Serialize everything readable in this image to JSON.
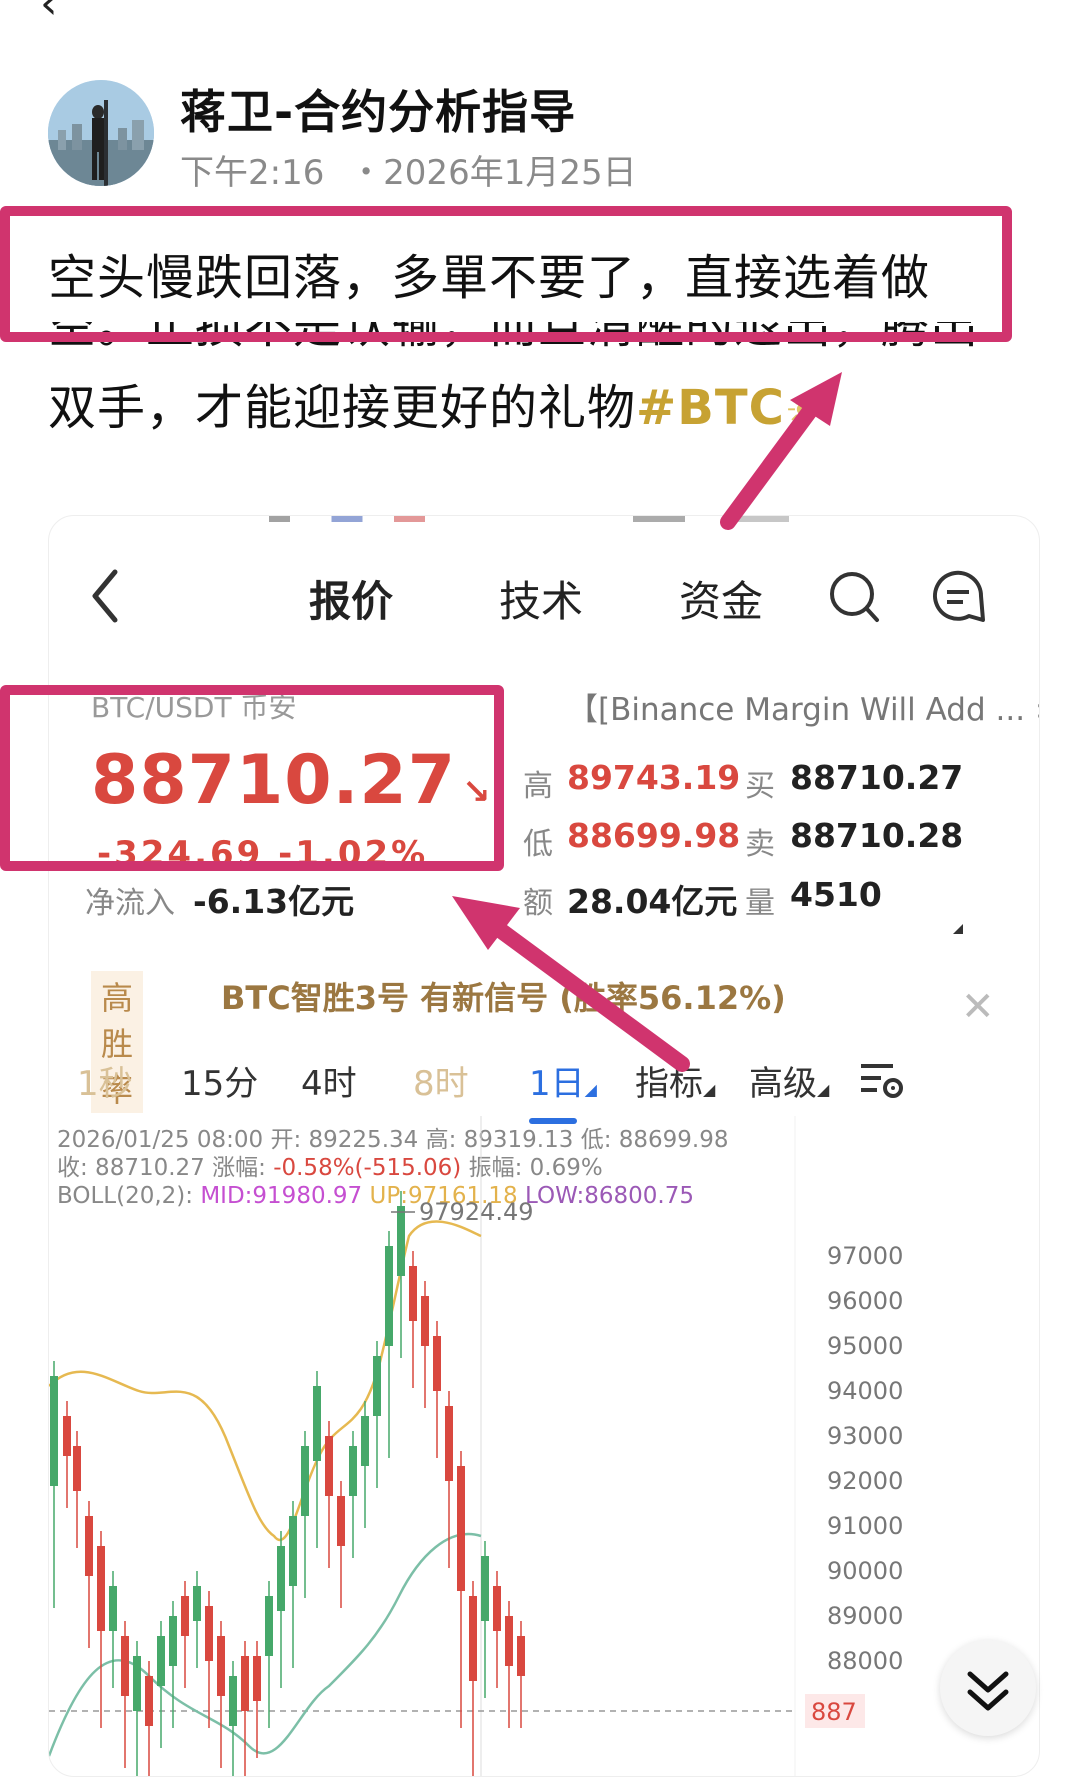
{
  "post": {
    "author": "蒋卫-合约分析指导",
    "time": "下午2:16",
    "date": "・2026年1月25日",
    "line1": "空头慢跌回落，多單不要了，直接选着做",
    "line2": "空。止损不是认输，而且清醒的退出，腾出",
    "line3": "双手，才能迎接更好的礼物",
    "hashtag": "#BTC"
  },
  "app": {
    "tabs": [
      "报价",
      "技术",
      "资金"
    ],
    "pair": "BTC/USDT 币安",
    "price": "88710.27",
    "price_sub": "-324.69   -1.02%",
    "news": "【[Binance Margin Will Add ...",
    "stats": {
      "high_label": "高",
      "high": "89743.19",
      "low_label": "低",
      "low": "88699.98",
      "buy_label": "买",
      "buy": "88710.27",
      "sell_label": "卖",
      "sell": "88710.28",
      "inflow_label": "净流入",
      "inflow": "-6.13亿元",
      "amount_label": "额",
      "amount": "28.04亿元",
      "volume_label": "量",
      "volume": "4510"
    },
    "signal": {
      "badge": "高胜率",
      "text": "BTC智胜3号 有新信号 (胜率56.12%)"
    },
    "intervals": [
      "1秒",
      "15分",
      "4时",
      "8时",
      "1日",
      "指标",
      "高级"
    ],
    "ohlc": {
      "line1": "2026/01/25 08:00 开: 89225.34 高: 89319.13 低: 88699.98",
      "line2_a": "收: 88710.27 涨幅: ",
      "line2_b": "-0.58%(-515.06)",
      "line2_c": " 振幅: 0.69%",
      "boll": "BOLL(20,2): ",
      "mid": "MID:91980.97",
      "up": "UP:97161.18",
      "low": "LOW:86800.75"
    },
    "max_label": "97924.49",
    "last_label": "887",
    "y_ticks": [
      "97000",
      "96000",
      "95000",
      "94000",
      "93000",
      "92000",
      "91000",
      "90000",
      "89000",
      "88000"
    ]
  }
}
